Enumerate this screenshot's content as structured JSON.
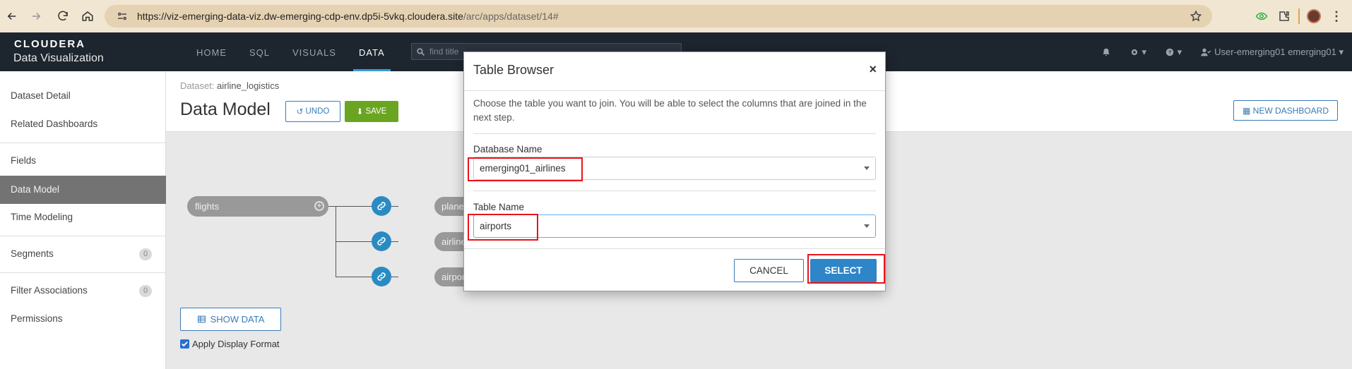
{
  "browser": {
    "url_host": "https://viz-emerging-data-viz.dw-emerging-cdp-env.dp5i-5vkq.cloudera.site",
    "url_path": "/arc/apps/dataset/14#"
  },
  "header": {
    "brand_top": "CLOUDERA",
    "brand_bottom": "Data Visualization",
    "nav": [
      "HOME",
      "SQL",
      "VISUALS",
      "DATA"
    ],
    "active_nav": "DATA",
    "search_placeholder": "find title",
    "user": "User-emerging01 emerging01"
  },
  "sidebar": {
    "items": [
      "Dataset Detail",
      "Related Dashboards",
      "Fields",
      "Data Model",
      "Time Modeling",
      "Segments",
      "Filter Associations",
      "Permissions"
    ],
    "active": "Data Model",
    "segments_count": "0",
    "filter_assoc_count": "0"
  },
  "main": {
    "dataset_prefix": "Dataset:",
    "dataset_name": "airline_logistics",
    "title": "Data Model",
    "undo_label": "UNDO",
    "save_label": "SAVE",
    "new_dashboard_label": "NEW DASHBOARD",
    "root_node": "flights",
    "child_nodes": [
      "planes",
      "airlines",
      "airports"
    ],
    "show_data_label": "SHOW DATA",
    "apply_format_label": "Apply Display Format"
  },
  "modal": {
    "title": "Table Browser",
    "close": "×",
    "description": "Choose the table you want to join. You will be able to select the columns that are joined in the next step.",
    "db_label": "Database Name",
    "db_value": "emerging01_airlines",
    "table_label": "Table Name",
    "table_value": "airports",
    "cancel_label": "CANCEL",
    "select_label": "SELECT"
  },
  "colors": {
    "accent": "#2e85c8",
    "save_green": "#6aa521",
    "header_bg": "#1d252e",
    "highlight": "#e8141c"
  }
}
